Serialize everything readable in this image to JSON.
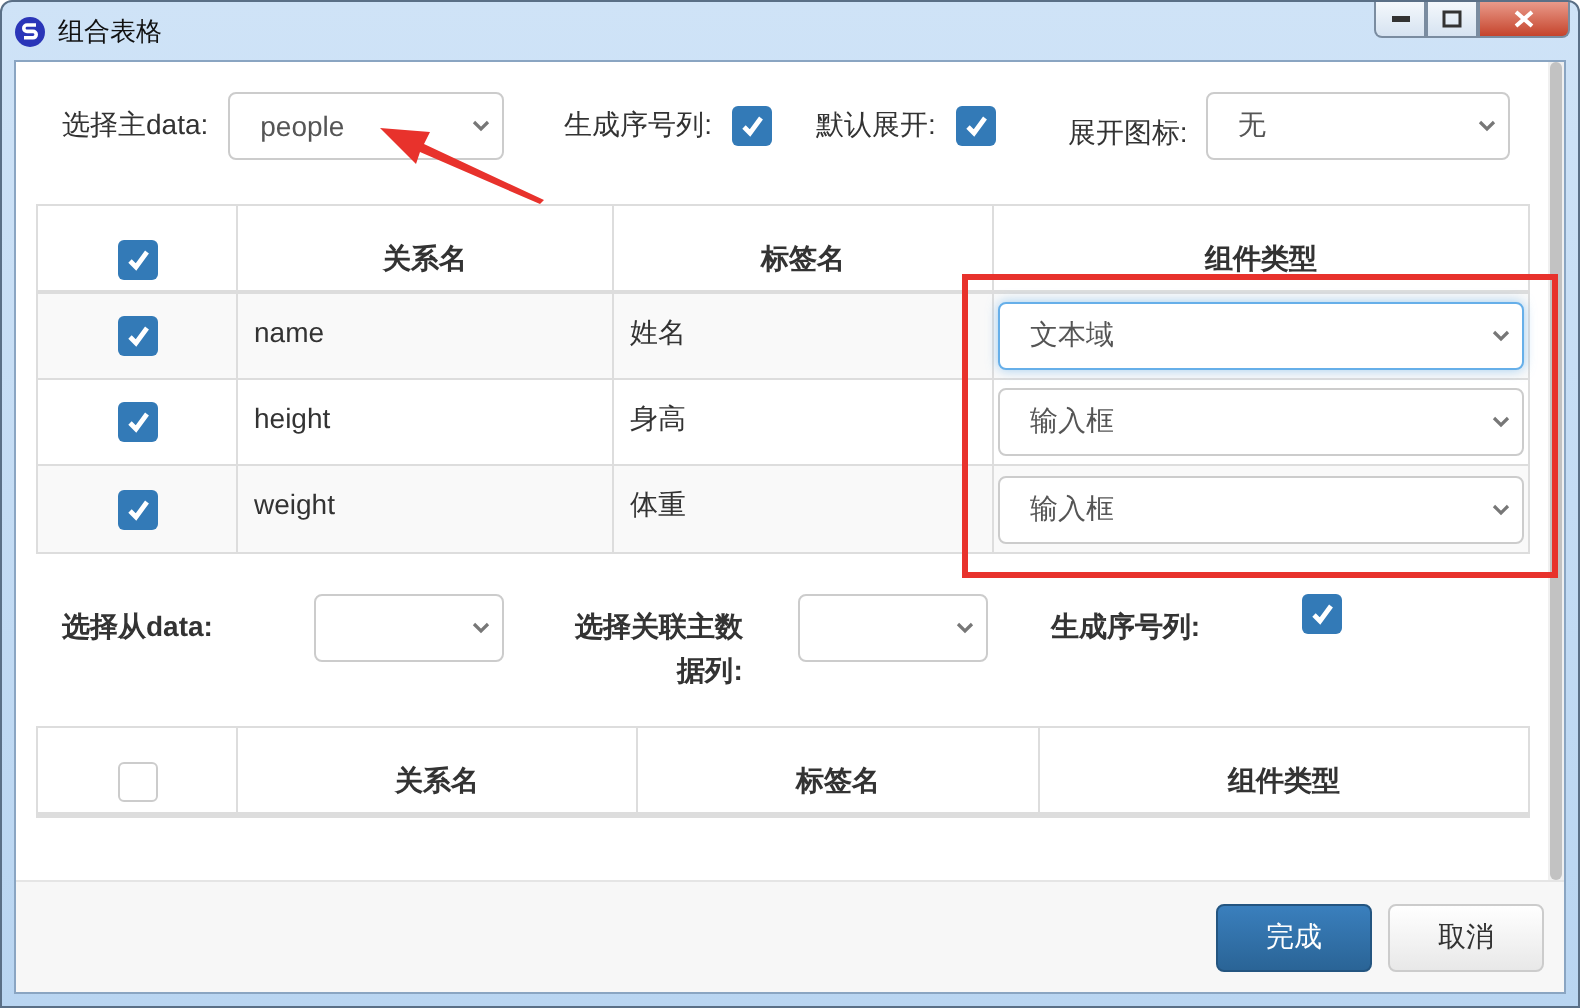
{
  "window": {
    "title": "组合表格"
  },
  "master": {
    "label": "选择主data:",
    "value": "people",
    "serial": {
      "label": "生成序号列:",
      "checked": true
    },
    "expand": {
      "label": "默认展开:",
      "checked": true
    },
    "icon": {
      "label": "展开图标:",
      "value": "无"
    }
  },
  "main_table": {
    "header_checked": true,
    "columns": [
      "关系名",
      "标签名",
      "组件类型"
    ],
    "rows": [
      {
        "checked": true,
        "relation": "name",
        "label": "姓名",
        "component": "文本域",
        "focused": true
      },
      {
        "checked": true,
        "relation": "height",
        "label": "身高",
        "component": "输入框",
        "focused": false
      },
      {
        "checked": true,
        "relation": "weight",
        "label": "体重",
        "component": "输入框",
        "focused": false
      }
    ]
  },
  "detail": {
    "label": "选择从data:",
    "link_label": "选择关联主数据列:",
    "serial": {
      "label": "生成序号列:",
      "checked": true
    }
  },
  "detail_table": {
    "header_checked": false,
    "columns": [
      "关系名",
      "标签名",
      "组件类型"
    ]
  },
  "buttons": [
    {
      "label": "完成",
      "kind": "primary"
    },
    {
      "label": "取消",
      "kind": "default"
    }
  ]
}
